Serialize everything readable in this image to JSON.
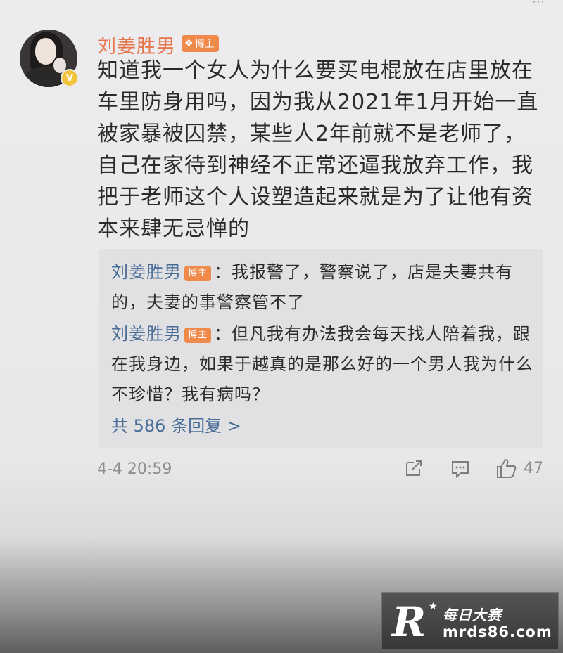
{
  "post": {
    "author": "刘姜胜男",
    "badge": "博主",
    "content": "知道我一个女人为什么要买电棍放在店里放在车里防身用吗，因为我从2021年1月开始一直被家暴被囚禁，某些人2年前就不是老师了，自己在家待到神经不正常还逼我放弃工作，我把于老师这个人设塑造起来就是为了让他有资本来肆无忌惮的",
    "timestamp": "4-4 20:59",
    "like_count": "47"
  },
  "replies": {
    "items": [
      {
        "name": "刘姜胜男",
        "badge": "博主",
        "text": "：我报警了，警察说了，店是夫妻共有的，夫妻的事警察管不了"
      },
      {
        "name": "刘姜胜男",
        "badge": "博主",
        "text": "：但凡我有办法我会每天找人陪着我，跟在我身边，如果于越真的是那么好的一个男人我为什么不珍惜？我有病吗？"
      }
    ],
    "more": "共 586 条回复 >"
  },
  "watermark": {
    "logo": "R",
    "name": "每日大赛",
    "url": "mrds86.com"
  },
  "icons": {
    "verified": "verified-icon",
    "share": "share-icon",
    "comment": "comment-icon",
    "like": "like-icon"
  },
  "colors": {
    "author": "#e9744b",
    "reply_name": "#4a6d98",
    "badge": "#f08a4b",
    "verified": "#f3c43b"
  }
}
